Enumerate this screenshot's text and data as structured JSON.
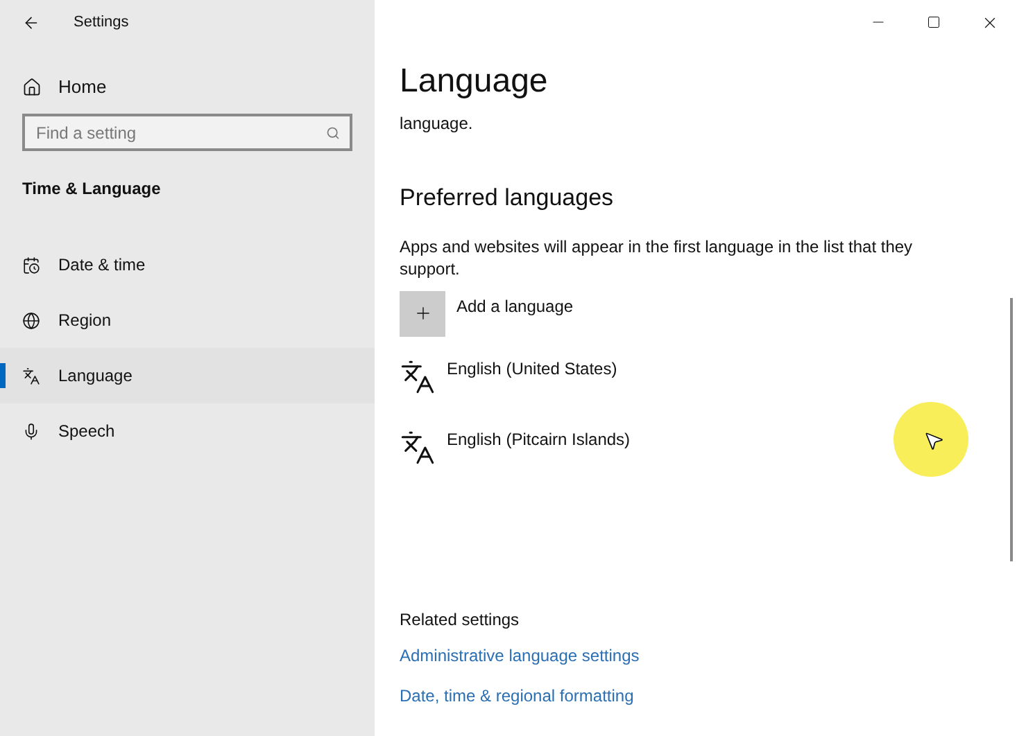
{
  "window": {
    "title": "Settings"
  },
  "sidebar": {
    "home": "Home",
    "search": {
      "placeholder": "Find a setting"
    },
    "section": "Time & Language",
    "items": [
      {
        "label": "Date & time",
        "kind": "date",
        "selected": false
      },
      {
        "label": "Region",
        "kind": "region",
        "selected": false
      },
      {
        "label": "Language",
        "kind": "language",
        "selected": true
      },
      {
        "label": "Speech",
        "kind": "speech",
        "selected": false
      }
    ]
  },
  "page": {
    "title": "Language",
    "intro_tail": "language.",
    "preferred": {
      "heading": "Preferred languages",
      "description": "Apps and websites will appear in the first language in the list that they support.",
      "add": "Add a language",
      "languages": [
        "English (United States)",
        "English (Pitcairn Islands)"
      ]
    },
    "related": {
      "heading": "Related settings",
      "links": [
        "Administrative language settings",
        "Date, time & regional formatting"
      ]
    }
  }
}
